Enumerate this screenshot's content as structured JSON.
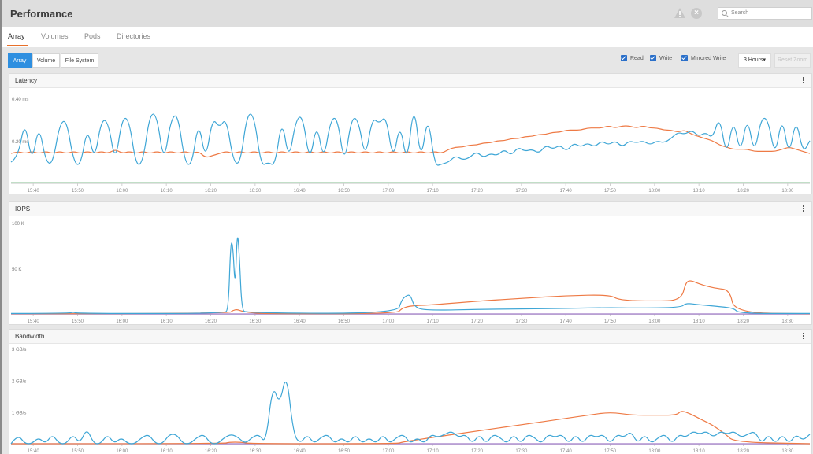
{
  "header": {
    "title": "Performance",
    "search_placeholder": "Search",
    "icons": [
      "alert-triangle-icon",
      "close-circle-icon",
      "search-icon"
    ]
  },
  "tabs": [
    {
      "label": "Array",
      "active": true
    },
    {
      "label": "Volumes",
      "active": false
    },
    {
      "label": "Pods",
      "active": false
    },
    {
      "label": "Directories",
      "active": false
    }
  ],
  "toolbar": {
    "scope_buttons": [
      {
        "label": "Array",
        "active": true
      },
      {
        "label": "Volume",
        "active": false
      },
      {
        "label": "File System",
        "active": false
      }
    ],
    "checkboxes": [
      {
        "label": "Read",
        "checked": true
      },
      {
        "label": "Write",
        "checked": true
      },
      {
        "label": "Mirrored Write",
        "checked": true
      }
    ],
    "range_label": "3 Hours▾",
    "reset_zoom_label": "Reset Zoom"
  },
  "colors": {
    "read": "#3ea6d6",
    "write": "#ee7a45",
    "mirrored_write": "#5aa86a",
    "baseline_purple": "#a07ac8",
    "accent": "#2e8fe0",
    "tab_underline": "#e8702a"
  },
  "chart_data": [
    {
      "type": "line",
      "title": "Latency",
      "ylabel": "ms",
      "ylim": [
        0,
        0.44
      ],
      "yticks": [
        {
          "value": 0.2,
          "label": "0.20 ms"
        },
        {
          "value": 0.4,
          "label": "0.40 ms"
        }
      ],
      "xlim": [
        "15:35",
        "18:35"
      ],
      "xticks": [
        "15:40",
        "15:50",
        "16:00",
        "16:10",
        "16:20",
        "16:30",
        "16:40",
        "16:50",
        "17:00",
        "17:10",
        "17:20",
        "17:30",
        "17:40",
        "17:50",
        "18:00",
        "18:10",
        "18:20",
        "18:30"
      ],
      "grid": false,
      "series": [
        {
          "name": "Read",
          "color_key": "read",
          "pattern": "spiky",
          "values": [
            0.1,
            0.12,
            0.3,
            0.09,
            0.28,
            0.1,
            0.09,
            0.28,
            0.3,
            0.1,
            0.08,
            0.27,
            0.1,
            0.3,
            0.29,
            0.09,
            0.31,
            0.3,
            0.08,
            0.1,
            0.33,
            0.32,
            0.09,
            0.3,
            0.33,
            0.1,
            0.08,
            0.3,
            0.1,
            0.31,
            0.26,
            0.31,
            0.1,
            0.09,
            0.33,
            0.32,
            0.08,
            0.1,
            0.08,
            0.31,
            0.1,
            0.3,
            0.32,
            0.09,
            0.29,
            0.1,
            0.3,
            0.31,
            0.08,
            0.31,
            0.3,
            0.11,
            0.31,
            0.28,
            0.32,
            0.1,
            0.29,
            0.08,
            0.39,
            0.09,
            0.33,
            0.08,
            0.09,
            0.1,
            0.13,
            0.11,
            0.12,
            0.15,
            0.12,
            0.14,
            0.13,
            0.16,
            0.13,
            0.17,
            0.15,
            0.16,
            0.14,
            0.18,
            0.16,
            0.18,
            0.15,
            0.19,
            0.17,
            0.19,
            0.17,
            0.2,
            0.18,
            0.2,
            0.17,
            0.2,
            0.19,
            0.2,
            0.18,
            0.2,
            0.19,
            0.21,
            0.24,
            0.23,
            0.25,
            0.22,
            0.24,
            0.21,
            0.32,
            0.12,
            0.31,
            0.13,
            0.32,
            0.13,
            0.31,
            0.3,
            0.12,
            0.32,
            0.12,
            0.31,
            0.14,
            0.2
          ]
        },
        {
          "name": "Write",
          "color_key": "write",
          "values": [
            0.14,
            0.15,
            0.14,
            0.15,
            0.14,
            0.15,
            0.14,
            0.15,
            0.14,
            0.15,
            0.14,
            0.15,
            0.14,
            0.15,
            0.14,
            0.16,
            0.14,
            0.15,
            0.14,
            0.15,
            0.14,
            0.15,
            0.14,
            0.15,
            0.14,
            0.15,
            0.14,
            0.15,
            0.12,
            0.13,
            0.14,
            0.15,
            0.14,
            0.15,
            0.14,
            0.15,
            0.14,
            0.15,
            0.14,
            0.15,
            0.14,
            0.15,
            0.14,
            0.15,
            0.14,
            0.15,
            0.14,
            0.15,
            0.14,
            0.15,
            0.14,
            0.15,
            0.14,
            0.15,
            0.14,
            0.15,
            0.14,
            0.15,
            0.14,
            0.15,
            0.14,
            0.15,
            0.14,
            0.16,
            0.17,
            0.17,
            0.18,
            0.18,
            0.19,
            0.19,
            0.2,
            0.2,
            0.21,
            0.21,
            0.22,
            0.22,
            0.23,
            0.23,
            0.24,
            0.24,
            0.25,
            0.25,
            0.25,
            0.26,
            0.26,
            0.26,
            0.27,
            0.26,
            0.27,
            0.27,
            0.26,
            0.27,
            0.26,
            0.26,
            0.25,
            0.25,
            0.24,
            0.25,
            0.23,
            0.22,
            0.21,
            0.2,
            0.18,
            0.17,
            0.16,
            0.16,
            0.16,
            0.15,
            0.15,
            0.15,
            0.15,
            0.16,
            0.17,
            0.16,
            0.15,
            0.14
          ]
        },
        {
          "name": "Mirrored Write",
          "color_key": "mirrored_write",
          "values": [
            0.003,
            0.003,
            0.003,
            0.003,
            0.003,
            0.003,
            0.003,
            0.003,
            0.003,
            0.003
          ]
        }
      ]
    },
    {
      "type": "line",
      "title": "IOPS",
      "ylabel": "IOPS",
      "ylim": [
        0,
        105000
      ],
      "yticks": [
        {
          "value": 50000,
          "label": "50 K"
        },
        {
          "value": 100000,
          "label": "100 K"
        }
      ],
      "xlim": [
        "15:35",
        "18:35"
      ],
      "xticks": [
        "15:40",
        "15:50",
        "16:00",
        "16:10",
        "16:20",
        "16:30",
        "16:40",
        "16:50",
        "17:00",
        "17:10",
        "17:20",
        "17:30",
        "17:40",
        "17:50",
        "18:00",
        "18:10",
        "18:20",
        "18:30"
      ],
      "grid": false,
      "series": [
        {
          "name": "Read",
          "color_key": "read",
          "points": [
            [
              "15:35",
              500
            ],
            [
              "15:48",
              800
            ],
            [
              "15:49",
              2000
            ],
            [
              "15:50",
              500
            ],
            [
              "16:23",
              500
            ],
            [
              "16:24",
              5000
            ],
            [
              "16:24.5",
              80000
            ],
            [
              "16:25",
              75000
            ],
            [
              "16:25.5",
              25000
            ],
            [
              "16:26",
              95000
            ],
            [
              "16:26.5",
              60000
            ],
            [
              "16:27",
              5000
            ],
            [
              "16:28",
              1000
            ],
            [
              "17:02",
              500
            ],
            [
              "17:03",
              15000
            ],
            [
              "17:04",
              20000
            ],
            [
              "17:05",
              21000
            ],
            [
              "17:06",
              6000
            ],
            [
              "17:10",
              4000
            ],
            [
              "17:20",
              5000
            ],
            [
              "17:30",
              5500
            ],
            [
              "17:40",
              6000
            ],
            [
              "17:50",
              7000
            ],
            [
              "17:55",
              6500
            ],
            [
              "18:06",
              7000
            ],
            [
              "18:07",
              12000
            ],
            [
              "18:10",
              10000
            ],
            [
              "18:15",
              8000
            ],
            [
              "18:18",
              6000
            ],
            [
              "18:19",
              500
            ],
            [
              "18:35",
              500
            ]
          ]
        },
        {
          "name": "Write",
          "color_key": "write",
          "points": [
            [
              "15:35",
              300
            ],
            [
              "16:24",
              300
            ],
            [
              "16:25",
              4000
            ],
            [
              "16:26",
              5000
            ],
            [
              "16:27",
              3000
            ],
            [
              "16:29",
              1500
            ],
            [
              "16:32",
              300
            ],
            [
              "17:02",
              300
            ],
            [
              "17:03",
              6000
            ],
            [
              "17:05",
              9000
            ],
            [
              "17:10",
              10000
            ],
            [
              "17:20",
              14000
            ],
            [
              "17:30",
              17000
            ],
            [
              "17:40",
              20000
            ],
            [
              "17:50",
              21000
            ],
            [
              "17:52",
              15000
            ],
            [
              "18:00",
              14000
            ],
            [
              "18:06",
              15000
            ],
            [
              "18:07",
              34000
            ],
            [
              "18:08",
              37000
            ],
            [
              "18:10",
              33000
            ],
            [
              "18:12",
              30000
            ],
            [
              "18:14",
              28000
            ],
            [
              "18:17",
              26000
            ],
            [
              "18:18",
              1000
            ],
            [
              "18:35",
              300
            ]
          ]
        },
        {
          "name": "Mirrored Write",
          "color_key": "baseline_purple",
          "points": [
            [
              "15:35",
              0
            ],
            [
              "18:35",
              0
            ]
          ]
        }
      ]
    },
    {
      "type": "line",
      "title": "Bandwidth",
      "ylabel": "GB/s",
      "ylim": [
        0,
        3.1
      ],
      "yticks": [
        {
          "value": 1,
          "label": "1 GB/s"
        },
        {
          "value": 2,
          "label": "2 GB/s"
        },
        {
          "value": 3,
          "label": "3 GB/s"
        }
      ],
      "xlim": [
        "15:35",
        "18:35"
      ],
      "xticks": [
        "15:40",
        "15:50",
        "16:00",
        "16:10",
        "16:20",
        "16:30",
        "16:40",
        "16:50",
        "17:00",
        "17:10",
        "17:20",
        "17:30",
        "17:40",
        "17:50",
        "18:00",
        "18:10",
        "18:20",
        "18:30"
      ],
      "grid": false,
      "series": [
        {
          "name": "Read",
          "color_key": "read",
          "pattern": "bumps",
          "values": [
            0,
            0.3,
            0,
            0,
            0.2,
            0,
            0.3,
            0,
            0,
            0.3,
            0,
            0.5,
            0,
            0,
            0.3,
            0,
            0.2,
            0,
            0,
            0.2,
            0.3,
            0,
            0,
            0.3,
            0.3,
            0,
            0,
            0.2,
            0.3,
            0,
            0,
            0.2,
            0.3,
            0.2,
            0,
            0.2,
            0.3,
            0,
            1.9,
            1.2,
            2.3,
            0.3,
            0,
            0.3,
            0,
            0.2,
            0.3,
            0,
            0.2,
            0,
            0.3,
            0,
            0.2,
            0,
            0.3,
            0,
            0.2,
            0.3,
            0,
            0.2,
            0,
            0.3,
            0.2,
            0.3,
            0.4,
            0.2,
            0.3,
            0,
            0.3,
            0,
            0.3,
            0.2,
            0,
            0.3,
            0,
            0.3,
            0.2,
            0,
            0.3,
            0.2,
            0.3,
            0,
            0.3,
            0,
            0.3,
            0.2,
            0.3,
            0,
            0.3,
            0.2,
            0.4,
            0,
            0.3,
            0,
            0.2,
            0.3,
            0,
            0.3,
            0.2,
            0.4,
            0.3,
            0.4,
            0.2,
            0.4,
            0.3,
            0.4,
            0.2,
            0.3,
            0.4,
            0,
            0.3,
            0,
            0.3,
            0,
            0.3,
            0.1,
            0.3
          ]
        },
        {
          "name": "Write",
          "color_key": "write",
          "points": [
            [
              "15:35",
              0
            ],
            [
              "16:23",
              0
            ],
            [
              "16:24",
              0.05
            ],
            [
              "16:27",
              0.05
            ],
            [
              "16:29",
              0
            ],
            [
              "17:02",
              0
            ],
            [
              "17:03",
              0.05
            ],
            [
              "17:10",
              0.2
            ],
            [
              "17:20",
              0.4
            ],
            [
              "17:30",
              0.6
            ],
            [
              "17:40",
              0.8
            ],
            [
              "17:45",
              0.9
            ],
            [
              "17:50",
              1.0
            ],
            [
              "17:55",
              0.9
            ],
            [
              "18:00",
              0.9
            ],
            [
              "18:05",
              0.9
            ],
            [
              "18:06",
              1.05
            ],
            [
              "18:08",
              0.95
            ],
            [
              "18:10",
              0.8
            ],
            [
              "18:13",
              0.6
            ],
            [
              "18:16",
              0.3
            ],
            [
              "18:18",
              0.05
            ],
            [
              "18:35",
              0
            ]
          ]
        },
        {
          "name": "Mirrored Write",
          "color_key": "baseline_purple",
          "points": [
            [
              "15:35",
              0
            ],
            [
              "18:35",
              0
            ]
          ]
        }
      ]
    }
  ]
}
